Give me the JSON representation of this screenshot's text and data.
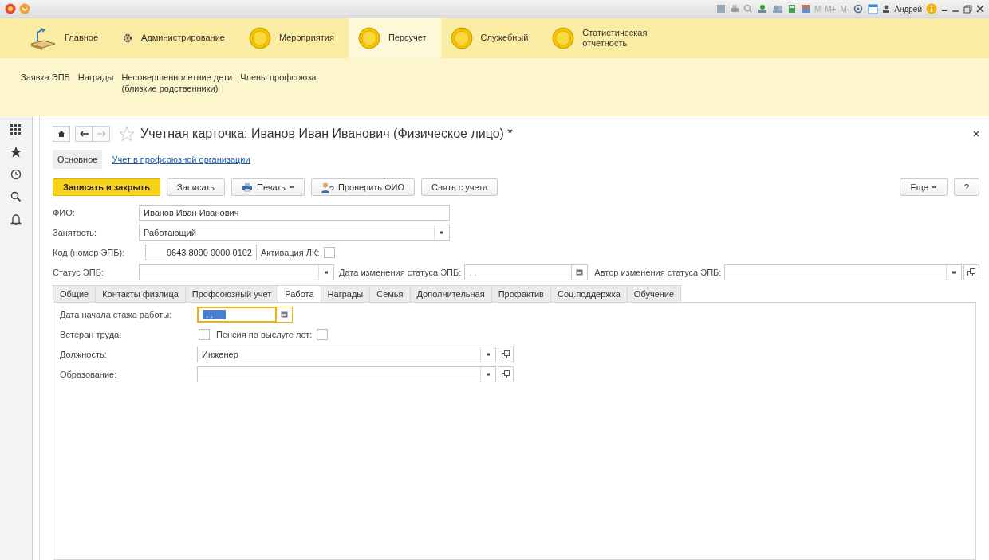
{
  "title_bar": {
    "memory_buttons": [
      "M",
      "M+",
      "M-"
    ],
    "user": "Андрей"
  },
  "sections": [
    {
      "label": "Главное",
      "kind": "home",
      "selected": false
    },
    {
      "label": "Администрирование",
      "kind": "admin",
      "selected": false
    },
    {
      "label": "Мероприятия",
      "kind": "subsystem",
      "selected": false
    },
    {
      "label": "Персучет",
      "kind": "subsystem",
      "selected": true
    },
    {
      "label": "Служебный",
      "kind": "subsystem",
      "selected": false
    },
    {
      "label": "Статистическая отчетность",
      "kind": "subsystem",
      "selected": false
    }
  ],
  "subnav": [
    "Заявка ЭПБ",
    "Награды",
    "Несовершеннолетние дети\n(близкие родственники)",
    "Члены профсоюза"
  ],
  "form": {
    "title": "Учетная карточка: Иванов Иван Иванович (Физическое лицо) *",
    "starred": false,
    "views": [
      {
        "label": "Основное",
        "selected": true
      },
      {
        "label": "Учет в профсоюзной организации",
        "selected": false
      }
    ],
    "commands": [
      {
        "kind": "primary",
        "label": "Записать и закрыть"
      },
      {
        "kind": "plain",
        "label": "Записать"
      },
      {
        "kind": "print",
        "label": "Печать"
      },
      {
        "kind": "check",
        "label": "Проверить ФИО"
      },
      {
        "kind": "plain",
        "label": "Снять с учета"
      }
    ],
    "more": "Еще",
    "help": "?",
    "fio": {
      "label": "ФИО:",
      "value": "Иванов Иван Иванович"
    },
    "employment": {
      "label": "Занятость:",
      "value": "Работающий"
    },
    "code": {
      "label": "Код (номер ЭПБ):",
      "value": "9643 8090 0000 0102"
    },
    "activation": {
      "label": "Активация ЛК:",
      "checked": false
    },
    "status": {
      "label": "Статус ЭПБ:"
    },
    "status_date": {
      "label": "Дата изменения статуса ЭПБ:",
      "placeholder": ". ."
    },
    "status_author": {
      "label": "Автор изменения статуса ЭПБ:"
    },
    "tabs": [
      {
        "label": "Общие",
        "selected": false
      },
      {
        "label": "Контакты физлица",
        "selected": false
      },
      {
        "label": "Профсоюзный учет",
        "selected": false
      },
      {
        "label": "Работа",
        "selected": true
      },
      {
        "label": "Награды",
        "selected": false
      },
      {
        "label": "Семья",
        "selected": false
      },
      {
        "label": "Дополнительная",
        "selected": false
      },
      {
        "label": "Профактив",
        "selected": false
      },
      {
        "label": "Соц.поддержка",
        "selected": false
      },
      {
        "label": "Обучение",
        "selected": false
      }
    ],
    "work": {
      "start_date": {
        "label": "Дата начала стажа работы:",
        "placeholder": ". ."
      },
      "veteran": {
        "label": "Ветеран труда:",
        "checked": false
      },
      "pension": {
        "label": "Пенсия по выслуге лет:",
        "checked": false
      },
      "position": {
        "label": "Должность:",
        "value": "Инженер"
      },
      "education": {
        "label": "Образование:"
      }
    }
  }
}
